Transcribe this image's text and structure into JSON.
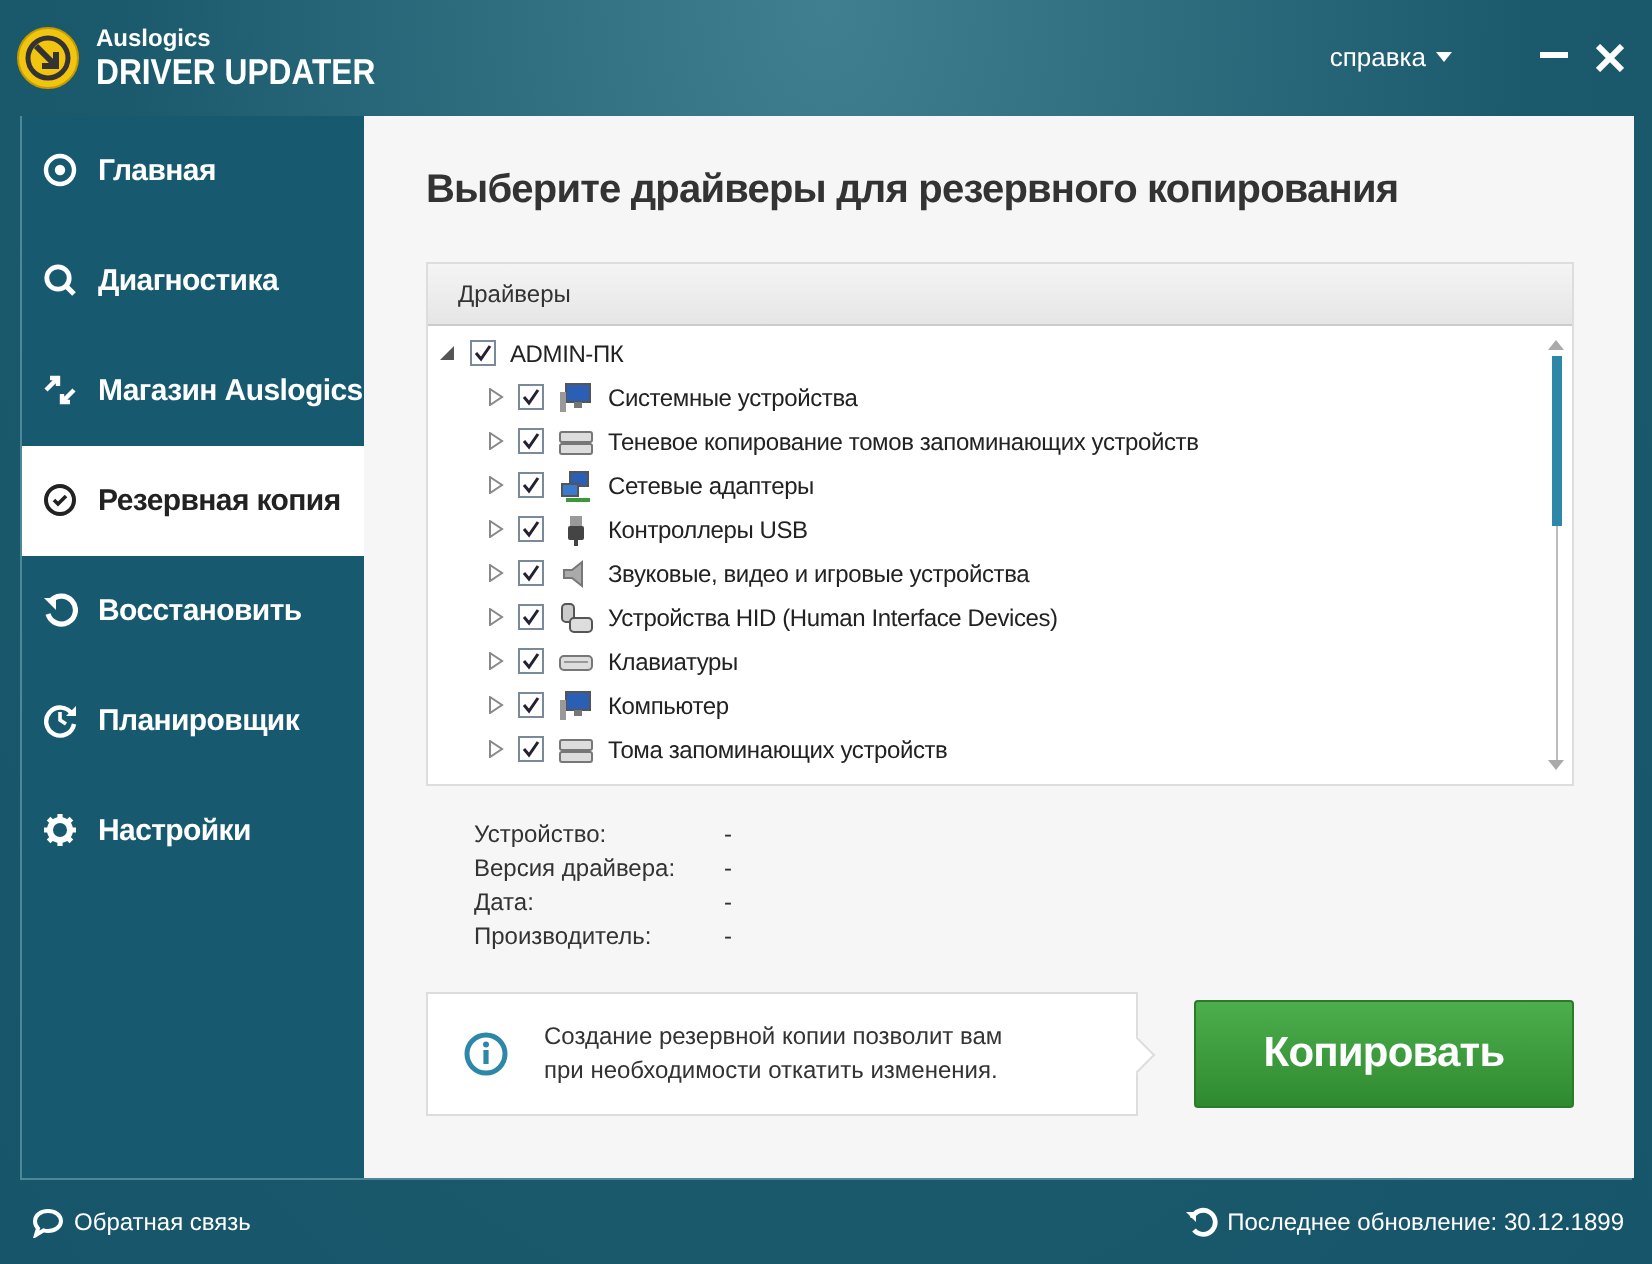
{
  "header": {
    "brand_small": "Auslogics",
    "brand_large": "DRIVER UPDATER",
    "help_menu": "справка"
  },
  "sidebar": {
    "items": [
      {
        "label": "Главная",
        "selected": false
      },
      {
        "label": "Диагностика",
        "selected": false
      },
      {
        "label": "Магазин Auslogics",
        "selected": false
      },
      {
        "label": "Резервная копия",
        "selected": true
      },
      {
        "label": "Восстановить",
        "selected": false
      },
      {
        "label": "Планировщик",
        "selected": false
      },
      {
        "label": "Настройки",
        "selected": false
      }
    ]
  },
  "main": {
    "title": "Выберите драйверы для резервного копирования",
    "tree": {
      "column": "Драйверы",
      "root": {
        "label": "ADMIN-ПК",
        "checked": true,
        "expanded": true,
        "children": [
          {
            "label": "Системные устройства",
            "kind": "computer",
            "checked": true,
            "expanded": false
          },
          {
            "label": "Теневое копирование томов запоминающих устройств",
            "kind": "drive",
            "checked": true,
            "expanded": false
          },
          {
            "label": "Сетевые адаптеры",
            "kind": "network",
            "checked": true,
            "expanded": false
          },
          {
            "label": "Контроллеры USB",
            "kind": "usb",
            "checked": true,
            "expanded": false
          },
          {
            "label": "Звуковые, видео и игровые устройства",
            "kind": "sound",
            "checked": true,
            "expanded": false
          },
          {
            "label": "Устройства HID (Human Interface Devices)",
            "kind": "hid",
            "checked": true,
            "expanded": false
          },
          {
            "label": "Клавиатуры",
            "kind": "keyboard",
            "checked": true,
            "expanded": false
          },
          {
            "label": "Компьютер",
            "kind": "computer",
            "checked": true,
            "expanded": false
          },
          {
            "label": "Тома запоминающих устройств",
            "kind": "drive",
            "checked": true,
            "expanded": false
          }
        ]
      }
    },
    "details": [
      {
        "label": "Устройство:",
        "value": "-"
      },
      {
        "label": "Версия драйвера:",
        "value": "-"
      },
      {
        "label": "Дата:",
        "value": "-"
      },
      {
        "label": "Производитель:",
        "value": "-"
      }
    ],
    "info": "Создание резервной копии позволит вам при необходимости откатить изменения.",
    "copy_button": "Копировать"
  },
  "footer": {
    "feedback": "Обратная связь",
    "last_update": "Последнее обновление: 30.12.1899"
  }
}
